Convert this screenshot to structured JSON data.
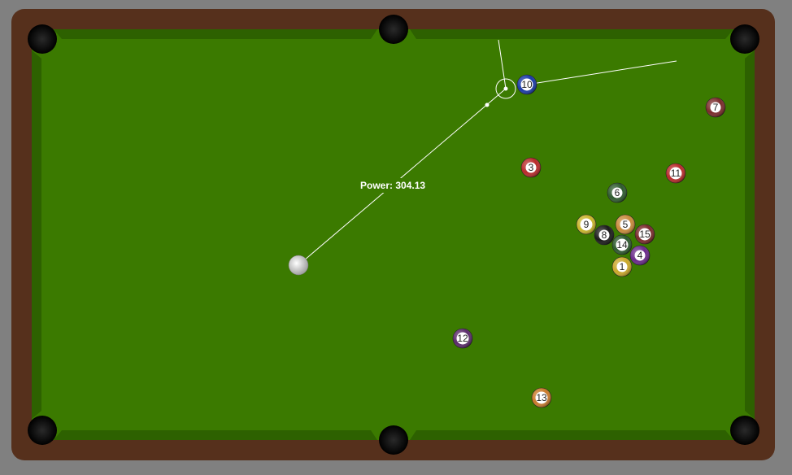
{
  "power_label": "Power: 304.13",
  "colors": {
    "background": "#808080",
    "rail": "#56301c",
    "felt": "#3b7a00",
    "cushion": "#2d6100",
    "pocket": "#0d0d0d",
    "aim_line": "#ffffff"
  },
  "balls": [
    {
      "number": "1",
      "color": "#c9a72a",
      "striped": false
    },
    {
      "number": "3",
      "color": "#b82a2a",
      "striped": false
    },
    {
      "number": "4",
      "color": "#6a2a8a",
      "striped": false
    },
    {
      "number": "5",
      "color": "#c98a3a",
      "striped": false
    },
    {
      "number": "6",
      "color": "#2e5a2e",
      "striped": false
    },
    {
      "number": "7",
      "color": "#7a2a2a",
      "striped": false
    },
    {
      "number": "8",
      "color": "#1a1a1a",
      "striped": false
    },
    {
      "number": "9",
      "color": "#c9b52a",
      "striped": true
    },
    {
      "number": "10",
      "color": "#1a3aa8",
      "striped": true
    },
    {
      "number": "11",
      "color": "#b82a2a",
      "striped": true
    },
    {
      "number": "12",
      "color": "#5a2a6a",
      "striped": true
    },
    {
      "number": "13",
      "color": "#c97a2a",
      "striped": true
    },
    {
      "number": "14",
      "color": "#2e5a2e",
      "striped": true
    },
    {
      "number": "15",
      "color": "#7a2a2a",
      "striped": true
    }
  ]
}
